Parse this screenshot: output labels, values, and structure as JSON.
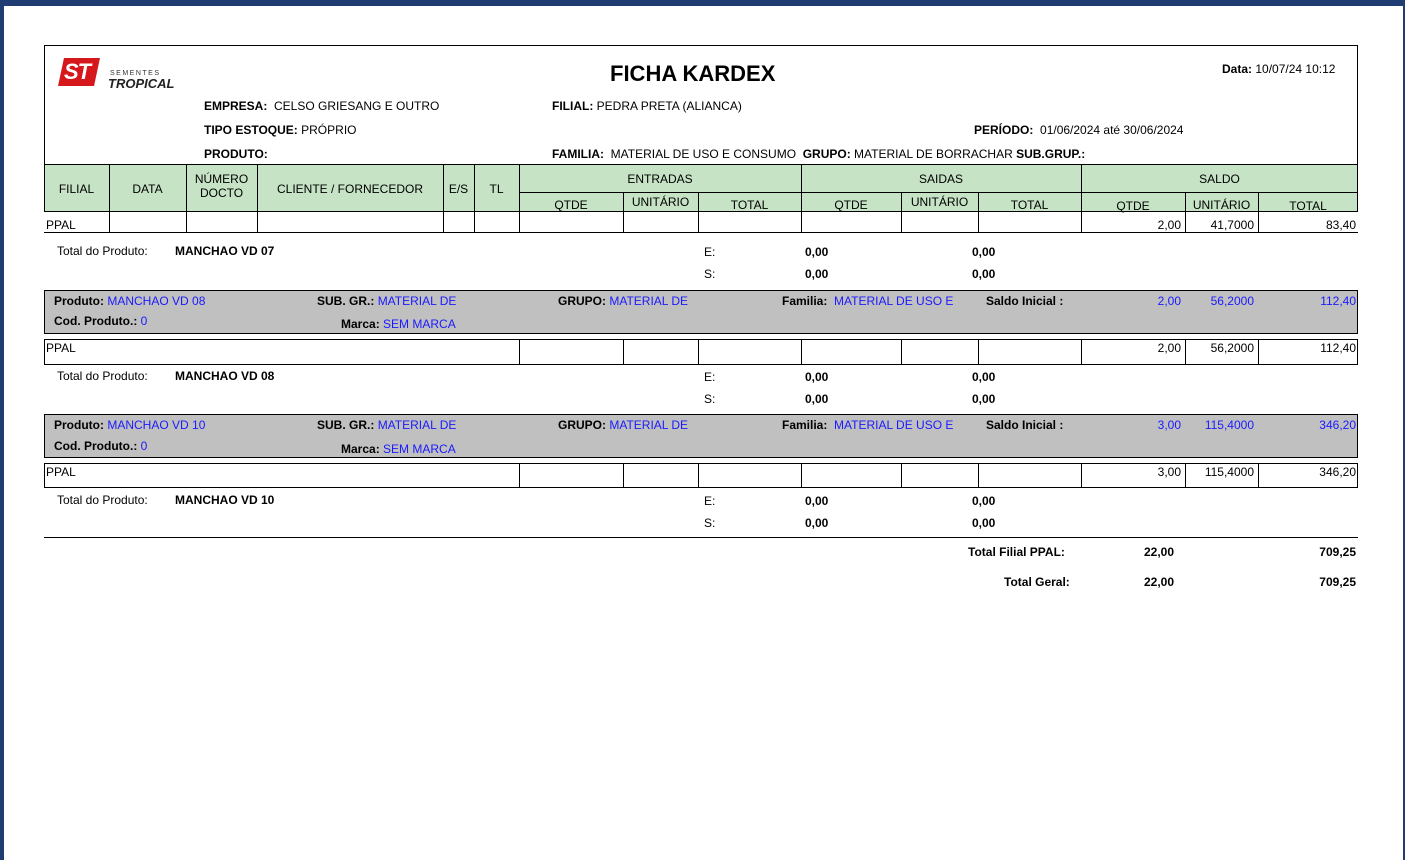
{
  "report": {
    "logo_initials": "ST",
    "logo_top": "SEMENTES",
    "logo_bottom": "TROPICAL",
    "title": "FICHA KARDEX",
    "data_label": "Data:",
    "data_value": "10/07/24 10:12",
    "empresa_label": "EMPRESA:",
    "empresa_value": "CELSO GRIESANG E OUTRO",
    "filial_label": "FILIAL:",
    "filial_value": "PEDRA PRETA (ALIANCA)",
    "tipo_label": "TIPO ESTOQUE:",
    "tipo_value": "PRÓPRIO",
    "periodo_label": "PERÍODO:",
    "periodo_value": "01/06/2024 até 30/06/2024",
    "produto_label": "PRODUTO:",
    "familia_label": "FAMILIA:",
    "familia_value": "MATERIAL DE USO E CONSUMO",
    "grupo_label": "GRUPO:",
    "grupo_value": "MATERIAL DE BORRACHAR",
    "subgrup_label": "SUB.GRUP.:"
  },
  "columns": {
    "filial": "FILIAL",
    "data": "DATA",
    "numero": "NÚMERO",
    "docto": "DOCTO",
    "cliente": "CLIENTE / FORNECEDOR",
    "es": "E/S",
    "tl": "TL",
    "entradas": "ENTRADAS",
    "saidas": "SAIDAS",
    "saldo": "SALDO",
    "qtde": "QTDE",
    "unitario": "UNITÁRIO",
    "total": "TOTAL"
  },
  "row07": {
    "filial": "PPAL",
    "qtde": "2,00",
    "unit": "41,7000",
    "total": "83,40"
  },
  "total07": {
    "label": "Total do Produto:",
    "name": "MANCHAO VD 07",
    "e": "E:",
    "s": "S:",
    "e1": "0,00",
    "e2": "0,00",
    "s1": "0,00",
    "s2": "0,00"
  },
  "prod08": {
    "produto_label": "Produto:",
    "produto": "MANCHAO VD 08",
    "subgr_label": "SUB. GR.:",
    "subgr": "MATERIAL DE",
    "grupo_label": "GRUPO:",
    "grupo": "MATERIAL DE",
    "familia_label": "Familia:",
    "familia": "MATERIAL DE USO E",
    "saldo_label": "Saldo Inicial :",
    "qtde": "2,00",
    "unit": "56,2000",
    "total": "112,40",
    "cod_label": "Cod. Produto.:",
    "cod": "0",
    "marca_label": "Marca:",
    "marca": "SEM MARCA"
  },
  "row08": {
    "filial": "PPAL",
    "qtde": "2,00",
    "unit": "56,2000",
    "total": "112,40"
  },
  "total08": {
    "label": "Total do Produto:",
    "name": "MANCHAO VD 08",
    "e": "E:",
    "s": "S:",
    "e1": "0,00",
    "e2": "0,00",
    "s1": "0,00",
    "s2": "0,00"
  },
  "prod10": {
    "produto_label": "Produto:",
    "produto": "MANCHAO VD 10",
    "subgr_label": "SUB. GR.:",
    "subgr": "MATERIAL DE",
    "grupo_label": "GRUPO:",
    "grupo": "MATERIAL DE",
    "familia_label": "Familia:",
    "familia": "MATERIAL DE USO E",
    "saldo_label": "Saldo Inicial :",
    "qtde": "3,00",
    "unit": "115,4000",
    "total": "346,20",
    "cod_label": "Cod. Produto.:",
    "cod": "0",
    "marca_label": "Marca:",
    "marca": "SEM MARCA"
  },
  "row10": {
    "filial": "PPAL",
    "qtde": "3,00",
    "unit": "115,4000",
    "total": "346,20"
  },
  "total10": {
    "label": "Total do Produto:",
    "name": "MANCHAO VD 10",
    "e": "E:",
    "s": "S:",
    "e1": "0,00",
    "e2": "0,00",
    "s1": "0,00",
    "s2": "0,00"
  },
  "totals": {
    "filial_label": "Total Filial PPAL:",
    "filial_qtde": "22,00",
    "filial_total": "709,25",
    "geral_label": "Total Geral:",
    "geral_qtde": "22,00",
    "geral_total": "709,25"
  },
  "colors": {
    "frame": "#1f3c73",
    "header_green": "#c6e3c6",
    "product_gray": "#c0c0c0",
    "value_blue": "#1a1aff",
    "logo_red": "#d4181b"
  }
}
